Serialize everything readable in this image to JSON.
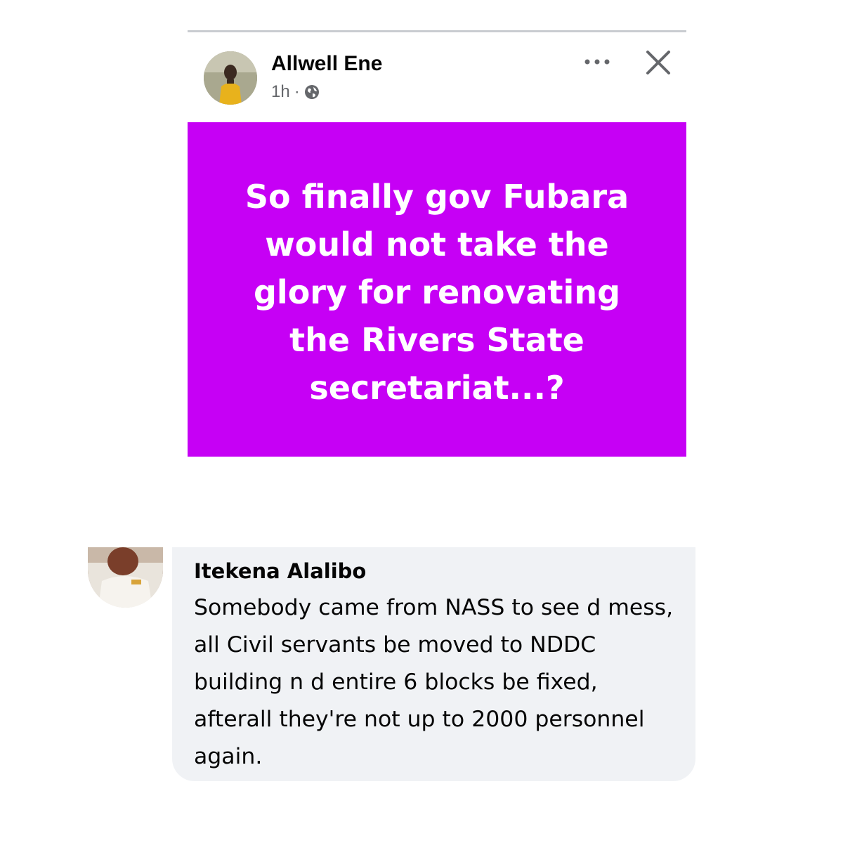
{
  "post": {
    "author": "Allwell Ene",
    "time": "1h",
    "separator": "·",
    "audience_icon": "globe-icon",
    "more_icon": "more-horizontal-icon",
    "close_icon": "close-icon",
    "status_text": "So finally gov Fubara would not take the glory for renovating the Rivers State secretariat...?",
    "background_color": "#c600f5"
  },
  "comment": {
    "author": "Itekena Alalibo",
    "text": "Somebody came from NASS to see d mess, all Civil servants be moved to NDDC building n d entire 6 blocks be fixed, afterall they're not up to 2000 personnel again.",
    "bubble_color": "#f0f2f5"
  }
}
